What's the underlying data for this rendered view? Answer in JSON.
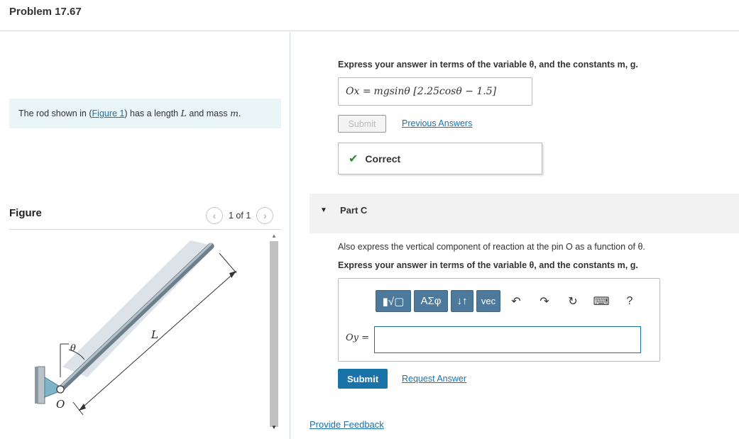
{
  "header": {
    "title": "Problem 17.67"
  },
  "statement": {
    "prefix": "The rod shown in (",
    "figure_link": "Figure 1",
    "mid": ") has a length ",
    "var_L": "L",
    "and_mass": " and mass ",
    "var_m": "m",
    "suffix": "."
  },
  "figure": {
    "label": "Figure",
    "counter": "1 of 1",
    "labels": {
      "theta": "θ",
      "L": "L",
      "O": "O"
    }
  },
  "partB": {
    "instruction": "Express your answer in terms of the variable θ, and the constants m, g.",
    "answer_label": "Ox =",
    "answer_value": "mgsinθ [2.25cosθ − 1.5]",
    "submit_label": "Submit",
    "previous_answers": "Previous Answers",
    "correct_text": "Correct"
  },
  "partC": {
    "label": "Part C",
    "description": "Also express the vertical component of reaction at the pin O as a function of θ.",
    "instruction": "Express your answer in terms of the variable θ, and the constants m, g.",
    "toolbar": {
      "templates": "▮√▢",
      "greek": "ΑΣφ",
      "sort": "↓↑",
      "vec": "vec",
      "help": "?"
    },
    "answer_label": "Oy =",
    "answer_value": "",
    "submit_label": "Submit",
    "request_answer": "Request Answer"
  },
  "footer": {
    "feedback": "Provide Feedback"
  },
  "colors": {
    "accent": "#1a73a8",
    "correct": "#2e8b2e",
    "statement_bg": "#e9f5f7",
    "toolbar_blue": "#4d7a9c"
  }
}
